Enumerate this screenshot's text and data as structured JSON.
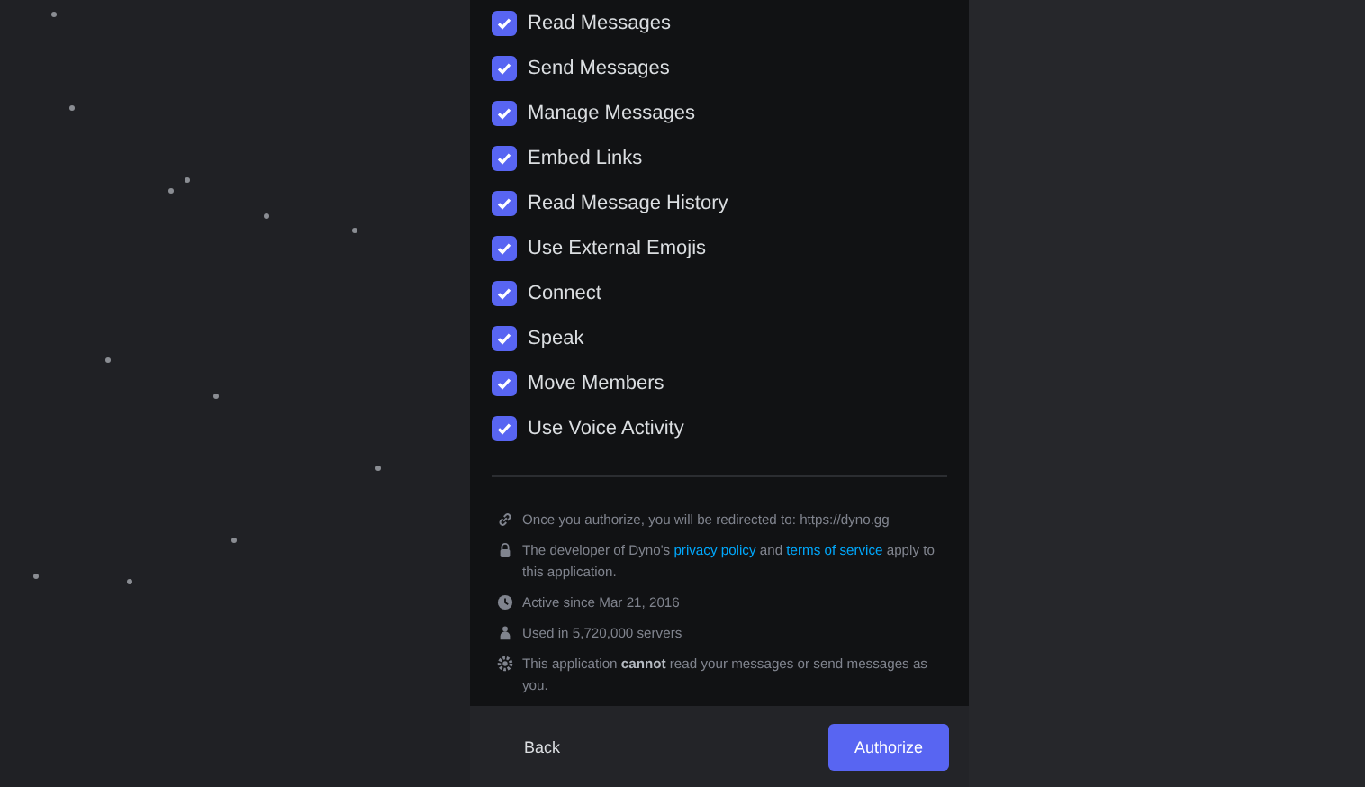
{
  "permissions": [
    {
      "label": "Read Messages",
      "checked": true
    },
    {
      "label": "Send Messages",
      "checked": true
    },
    {
      "label": "Manage Messages",
      "checked": true
    },
    {
      "label": "Embed Links",
      "checked": true
    },
    {
      "label": "Read Message History",
      "checked": true
    },
    {
      "label": "Use External Emojis",
      "checked": true
    },
    {
      "label": "Connect",
      "checked": true
    },
    {
      "label": "Speak",
      "checked": true
    },
    {
      "label": "Move Members",
      "checked": true
    },
    {
      "label": "Use Voice Activity",
      "checked": true
    }
  ],
  "notices": [
    {
      "kind": "link",
      "parts": [
        {
          "kind": "text",
          "text": "Once you authorize, you will be redirected to: https://dyno.gg"
        }
      ]
    },
    {
      "kind": "lock",
      "parts": [
        {
          "kind": "text",
          "text": "The developer of Dyno's "
        },
        {
          "kind": "link",
          "text": "privacy policy"
        },
        {
          "kind": "text",
          "text": " and "
        },
        {
          "kind": "link",
          "text": "terms of service"
        },
        {
          "kind": "text",
          "text": " apply to this application."
        }
      ]
    },
    {
      "kind": "clock",
      "parts": [
        {
          "kind": "text",
          "text": "Active since Mar 21, 2016"
        }
      ]
    },
    {
      "kind": "people",
      "parts": [
        {
          "kind": "text",
          "text": "Used in 5,720,000 servers"
        }
      ]
    },
    {
      "kind": "shield",
      "parts": [
        {
          "kind": "text",
          "text": "This application **cannot** read your messages or send messages as you."
        }
      ]
    }
  ],
  "buttons": {
    "back": "Back",
    "authorize": "Authorize"
  }
}
